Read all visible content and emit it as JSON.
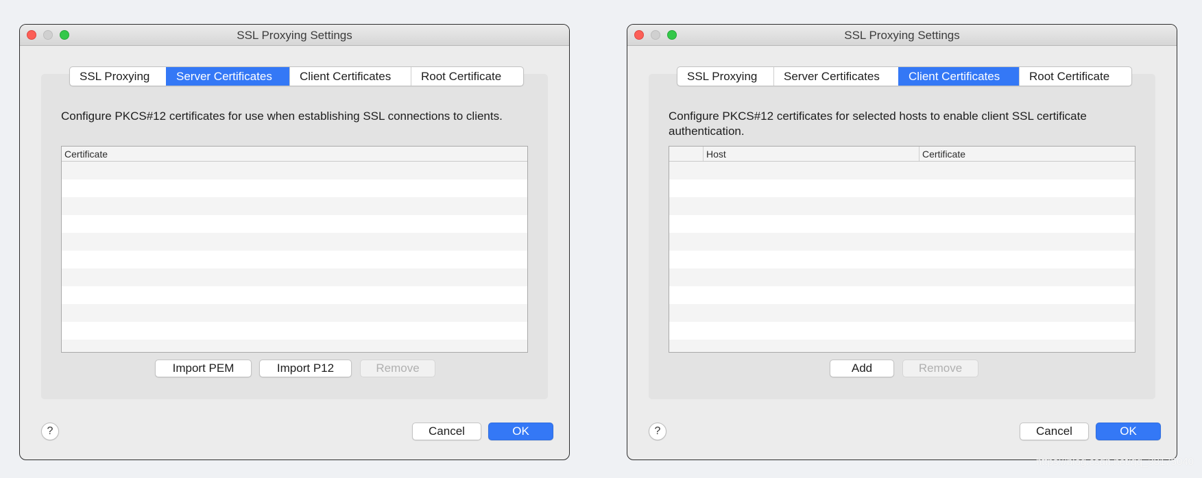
{
  "colors": {
    "accent": "#3478f6",
    "window_bg": "#ececec",
    "panel_bg": "#e3e3e3"
  },
  "left_window": {
    "title": "SSL Proxying Settings",
    "tabs": [
      {
        "label": "SSL Proxying",
        "active": false
      },
      {
        "label": "Server Certificates",
        "active": true
      },
      {
        "label": "Client Certificates",
        "active": false
      },
      {
        "label": "Root Certificate",
        "active": false
      }
    ],
    "description": "Configure PKCS#12 certificates for use when establishing SSL connections to clients.",
    "table": {
      "columns": [
        "Certificate"
      ],
      "rows": []
    },
    "buttons": {
      "import_pem": "Import PEM",
      "import_p12": "Import P12",
      "remove": "Remove"
    },
    "help_label": "?",
    "cancel_label": "Cancel",
    "ok_label": "OK"
  },
  "right_window": {
    "title": "SSL Proxying Settings",
    "tabs": [
      {
        "label": "SSL Proxying",
        "active": false
      },
      {
        "label": "Server Certificates",
        "active": false
      },
      {
        "label": "Client Certificates",
        "active": true
      },
      {
        "label": "Root Certificate",
        "active": false
      }
    ],
    "description": "Configure PKCS#12 certificates for selected hosts to enable client SSL certificate authentication.",
    "table": {
      "columns": [
        "",
        "Host",
        "Certificate"
      ],
      "rows": []
    },
    "buttons": {
      "add": "Add",
      "remove": "Remove"
    },
    "help_label": "?",
    "cancel_label": "Cancel",
    "ok_label": "OK"
  },
  "watermark": "https://blog.csdn.net/qq_38175040"
}
